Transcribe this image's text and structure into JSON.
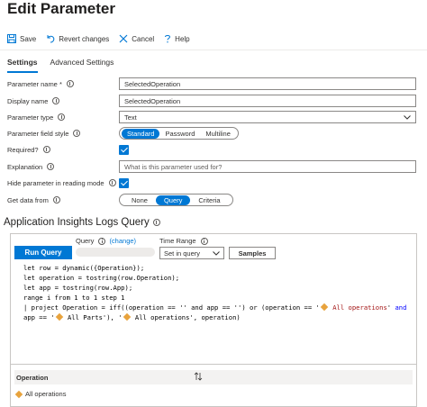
{
  "title": "Edit Parameter",
  "toolbar": {
    "save": "Save",
    "revert": "Revert changes",
    "cancel": "Cancel",
    "help": "Help"
  },
  "tabs": [
    {
      "label": "Settings",
      "active": true
    },
    {
      "label": "Advanced Settings",
      "active": false
    }
  ],
  "form": {
    "parameter_name": {
      "label": "Parameter name *",
      "value": "SelectedOperation"
    },
    "display_name": {
      "label": "Display name",
      "value": "SelectedOperation"
    },
    "parameter_type": {
      "label": "Parameter type",
      "value": "Text"
    },
    "field_style": {
      "label": "Parameter field style",
      "options": [
        "Standard",
        "Password",
        "Multiline"
      ],
      "selected": "Standard"
    },
    "required": {
      "label": "Required?",
      "checked": true
    },
    "explanation": {
      "label": "Explanation",
      "placeholder": "What is this parameter used for?"
    },
    "hide": {
      "label": "Hide parameter in reading mode",
      "checked": true
    },
    "get_data": {
      "label": "Get data from",
      "options": [
        "None",
        "Query",
        "Criteria"
      ],
      "selected": "Query"
    }
  },
  "section_title": "Application Insights Logs Query",
  "query": {
    "run_label": "Run Query",
    "query_label": "Query",
    "change_link": "(change)",
    "time_range_label": "Time Range",
    "time_range_value": "Set in query",
    "samples_label": "Samples",
    "code_lines": [
      "let row = dynamic({Operation});",
      "let operation = tostring(row.Operation);",
      "let app = tostring(row.App);",
      "range i from 1 to 1 step 1",
      "| project Operation = iff((operation == '' and app == '') or (operation == '",
      "app == '",
      " All Parts'), '"
    ],
    "code_tokens": {
      "all_operations_str": " All operations",
      "all_operations_end": "', operation)",
      "and_kw": "and"
    }
  },
  "results": {
    "column": "Operation",
    "rows": [
      "All operations"
    ]
  },
  "colors": {
    "accent": "#0078d4",
    "diamond": "#e8a33d"
  }
}
